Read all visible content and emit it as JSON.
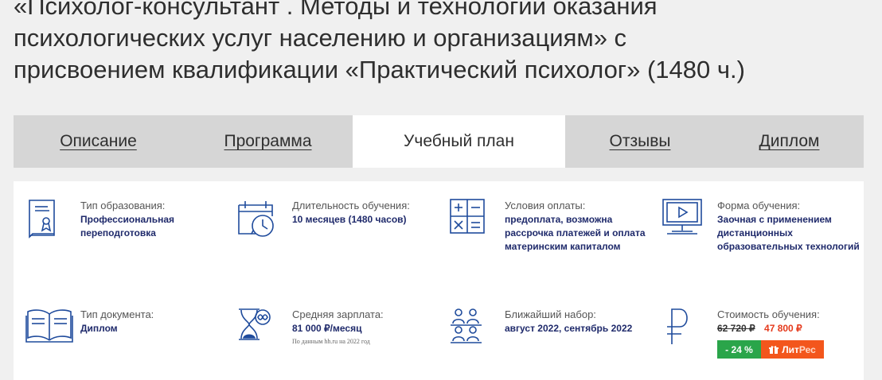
{
  "course": {
    "title": "«Психолог-консультант . Методы и технологии оказания психологических услуг населению и организациям» с присвоением квалификации «Практический психолог» (1480 ч.)"
  },
  "tabs": [
    {
      "label": "Описание",
      "active": false
    },
    {
      "label": "Программа",
      "active": false
    },
    {
      "label": "Учебный план",
      "active": true
    },
    {
      "label": "Отзывы",
      "active": false
    },
    {
      "label": "Диплом",
      "active": false
    }
  ],
  "info": {
    "education_type": {
      "label": "Тип образования:",
      "value": "Профессиональная переподготовка",
      "icon": "certificate-icon"
    },
    "duration": {
      "label": "Длительность обучения:",
      "value": "10 месяцев (1480 часов)",
      "icon": "calendar-clock-icon"
    },
    "payment": {
      "label": "Условия оплаты:",
      "value": "предоплата, возможна рассрочка платежей и оплата материнским капиталом",
      "icon": "calculator-icon"
    },
    "form": {
      "label": "Форма обучения:",
      "value": "Заочная с применением дистанционных образовательных технологий",
      "icon": "monitor-play-icon"
    },
    "document": {
      "label": "Тип документа:",
      "value": "Диплом",
      "icon": "open-book-icon"
    },
    "salary": {
      "label": "Средняя зарплата:",
      "value": "81 000 ₽/месяц",
      "note": "По данным hh.ru на 2022 год",
      "icon": "hourglass-infinity-icon"
    },
    "enrollment": {
      "label": "Ближайший набор:",
      "value": "август 2022, сентябрь 2022",
      "icon": "group-people-icon"
    },
    "cost": {
      "label": "Стоимость обучения:",
      "old_price": "62 720 ₽",
      "new_price": "47 800 ₽",
      "discount": "- 24 %",
      "litres_part1": "Лит",
      "litres_part2": "Рес",
      "icon": "ruble-icon"
    }
  },
  "colors": {
    "accent_text": "#1f2a6b",
    "icon_blue": "#1f4b9c",
    "price_red": "#e53a1c",
    "discount_green": "#2aa54a",
    "litres_orange": "#f3561c"
  }
}
